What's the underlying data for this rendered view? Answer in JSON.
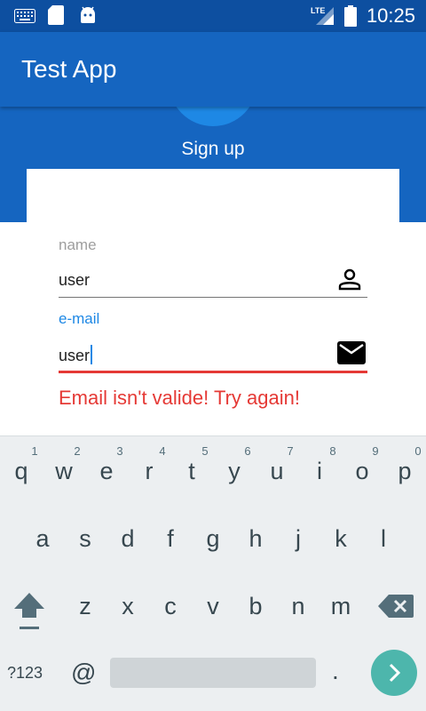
{
  "status_bar": {
    "time": "10:25",
    "network": "LTE",
    "icons": [
      "keyboard-icon",
      "sd-card-icon",
      "android-icon",
      "lte-signal-icon",
      "battery-icon"
    ]
  },
  "app_bar": {
    "title": "Test App"
  },
  "header": {
    "title": "Sign up"
  },
  "form": {
    "name": {
      "label": "name",
      "value": "user",
      "icon": "person-icon"
    },
    "email": {
      "label": "e-mail",
      "value": "user",
      "icon": "mail-icon"
    },
    "error": "Email isn't valide! Try again!"
  },
  "keyboard": {
    "row1": [
      "q",
      "w",
      "e",
      "r",
      "t",
      "y",
      "u",
      "i",
      "o",
      "p"
    ],
    "row1_hints": [
      "1",
      "2",
      "3",
      "4",
      "5",
      "6",
      "7",
      "8",
      "9",
      "0"
    ],
    "row2": [
      "a",
      "s",
      "d",
      "f",
      "g",
      "h",
      "j",
      "k",
      "l"
    ],
    "row3": [
      "z",
      "x",
      "c",
      "v",
      "b",
      "n",
      "m"
    ],
    "symbols_key": "?123",
    "at_key": "@",
    "period_key": ".",
    "icons": [
      "shift-icon",
      "backspace-icon",
      "enter-icon"
    ]
  },
  "colors": {
    "primary": "#1565c0",
    "status_bar": "#0d4fa0",
    "accent": "#1e88e5",
    "error": "#e53935",
    "keyboard_bg": "#eceff1",
    "enter_key": "#4db6ac"
  }
}
